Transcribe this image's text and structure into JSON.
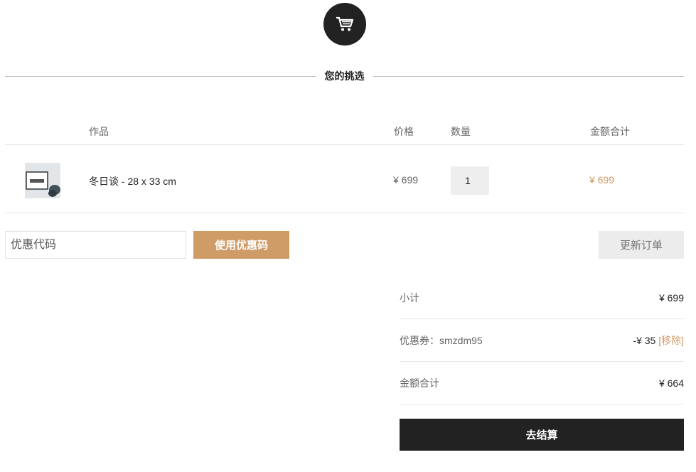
{
  "header": {
    "title": "您的挑选",
    "icon": "shopping-cart-icon"
  },
  "table": {
    "columns": [
      "作品",
      "价格",
      "数量",
      "金额合计"
    ],
    "items": [
      {
        "name": "冬日谈 - 28 x 33 cm",
        "price": "¥ 699",
        "quantity": "1",
        "total": "¥ 699"
      }
    ]
  },
  "coupon": {
    "placeholder": "优惠代码",
    "apply_label": "使用优惠码"
  },
  "update_label": "更新订单",
  "summary": {
    "subtotal_label": "小计",
    "subtotal_value": "¥ 699",
    "coupon_label": "优惠券：smzdm95",
    "coupon_value": "-¥ 35",
    "coupon_remove": "[移除]",
    "total_label": "金额合计",
    "total_value": "¥ 664"
  },
  "checkout_label": "去结算",
  "colors": {
    "accent": "#cf9b67",
    "dark": "#222222"
  }
}
